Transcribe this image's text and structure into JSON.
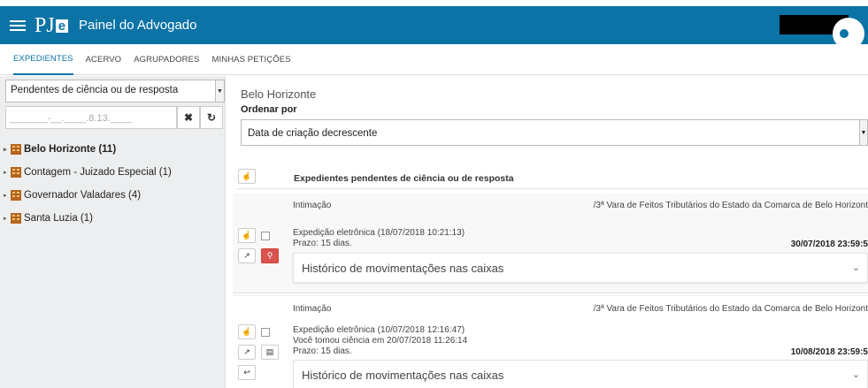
{
  "header": {
    "logo_p": "PJ",
    "logo_e": "e",
    "title": "Painel do Advogado"
  },
  "tabs": [
    {
      "label": "EXPEDIENTES"
    },
    {
      "label": "ACERVO"
    },
    {
      "label": "AGRUPADORES"
    },
    {
      "label": "MINHAS PETIÇÕES"
    }
  ],
  "sidebar": {
    "filter_select": "Pendentes de ciência ou de resposta",
    "process_input_placeholder": "_______-__.____.8.13.____",
    "clear_label": "✖",
    "refresh_label": "↻",
    "items": [
      {
        "label": "Belo Horizonte (11)"
      },
      {
        "label": "Contagem - Juizado Especial (1)"
      },
      {
        "label": "Governador Valadares (4)"
      },
      {
        "label": "Santa Luzia (1)"
      }
    ]
  },
  "main": {
    "city": "Belo Horizonte",
    "order_label": "Ordenar por",
    "order_value": "Data de criação decrescente",
    "list_title": "Expedientes pendentes de ciência ou de resposta",
    "cards": [
      {
        "type": "Intimação",
        "org": "/3ª Vara de Feitos Tributários do Estado da Comarca de Belo Horizont",
        "expedition": "Expedição eletrônica (18/07/2018 10:21:13)",
        "deadline": "Prazo: 15 dias.",
        "date": "30/07/2018 23:59:5",
        "history": "Histórico de movimentações nas caixas"
      },
      {
        "type": "Intimação",
        "org": "/3ª Vara de Feitos Tributários do Estado da Comarca de Belo Horizont",
        "expedition": "Expedição eletrônica (10/07/2018 12:16:47)",
        "ciencia": "Você tomou ciência em 20/07/2018 11:26:14",
        "deadline": "Prazo: 15 dias.",
        "date": "10/08/2018 23:59:5",
        "history": "Histórico de movimentações nas caixas"
      }
    ]
  },
  "colors": {
    "brand": "#0c73a6",
    "danger": "#d9534f",
    "sidebar_bg": "#eceeef"
  }
}
